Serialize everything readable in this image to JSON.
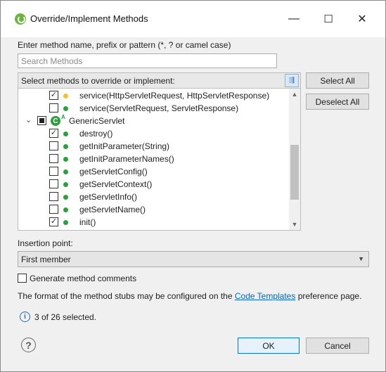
{
  "window": {
    "title": "Override/Implement Methods",
    "minimize_glyph": "—",
    "maximize_glyph": "☐",
    "close_glyph": "✕"
  },
  "search": {
    "label": "Enter method name, prefix or pattern (*, ? or camel case)",
    "placeholder": "Search Methods",
    "value": ""
  },
  "methods_tree": {
    "header": "Select methods to override or implement:",
    "rows": [
      {
        "text": "service(HttpServletRequest, HttpServletResponse)",
        "checked": true,
        "icon": "protected-method-icon"
      },
      {
        "text": "service(ServletRequest, ServletResponse)",
        "checked": false,
        "icon": "public-method-icon"
      },
      {
        "text": "GenericServlet",
        "checked": "partial",
        "icon": "abstract-class-icon",
        "expanded": true
      },
      {
        "text": "destroy()",
        "checked": true,
        "icon": "public-method-icon"
      },
      {
        "text": "getInitParameter(String)",
        "checked": false,
        "icon": "public-method-icon"
      },
      {
        "text": "getInitParameterNames()",
        "checked": false,
        "icon": "public-method-icon"
      },
      {
        "text": "getServletConfig()",
        "checked": false,
        "icon": "public-method-icon"
      },
      {
        "text": "getServletContext()",
        "checked": false,
        "icon": "public-method-icon"
      },
      {
        "text": "getServletInfo()",
        "checked": false,
        "icon": "public-method-icon"
      },
      {
        "text": "getServletName()",
        "checked": false,
        "icon": "public-method-icon"
      },
      {
        "text": "init()",
        "checked": true,
        "icon": "public-method-icon"
      }
    ]
  },
  "buttons": {
    "select_all": "Select All",
    "deselect_all": "Deselect All",
    "ok": "OK",
    "cancel": "Cancel"
  },
  "insertion": {
    "label": "Insertion point:",
    "value": "First member"
  },
  "generate_comments": {
    "label": "Generate method comments",
    "checked": false
  },
  "format_note": {
    "before": "The format of the method stubs may be configured on the",
    "link": "Code Templates",
    "after": "preference page."
  },
  "status": {
    "text": "3 of 26 selected."
  },
  "colors": {
    "public_method": "#2e9e3e",
    "protected_method": "#f2c230",
    "link": "#0066cc",
    "default_button_border": "#0078d7"
  }
}
